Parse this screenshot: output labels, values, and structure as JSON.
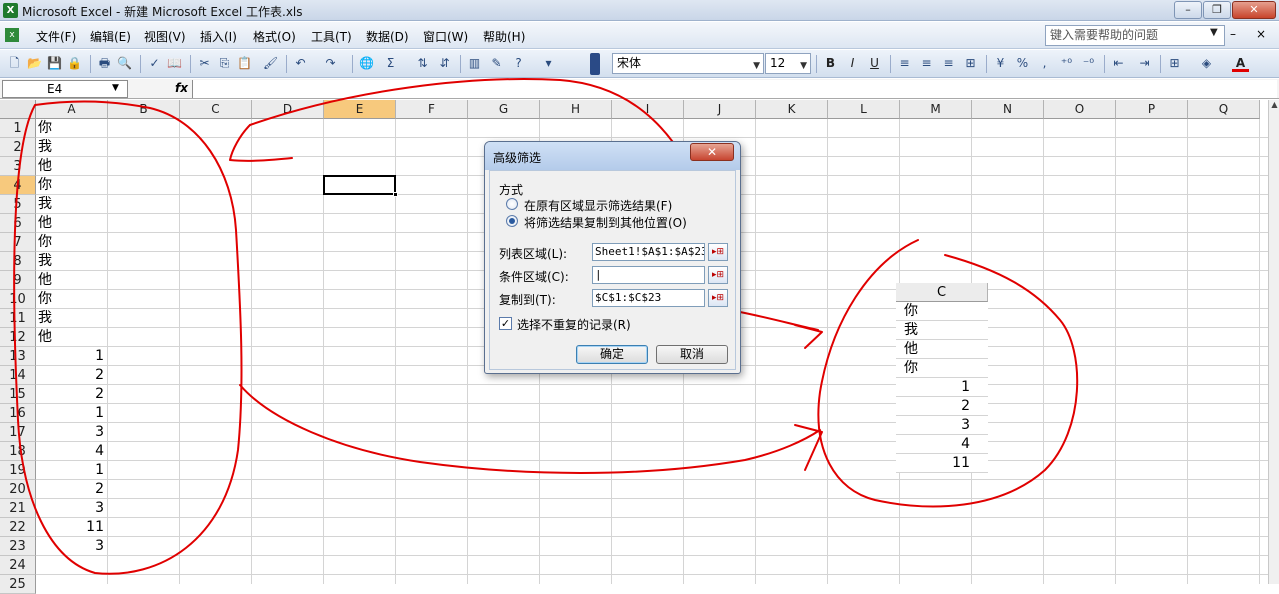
{
  "window": {
    "title": "Microsoft Excel - 新建 Microsoft Excel 工作表.xls",
    "app_icon": "X",
    "min_glyph": "–",
    "max_glyph": "❐",
    "close_glyph": "✕"
  },
  "menu": {
    "doc_icon": "x",
    "items": [
      "文件(F)",
      "编辑(E)",
      "视图(V)",
      "插入(I)",
      "格式(O)",
      "工具(T)",
      "数据(D)",
      "窗口(W)",
      "帮助(H)"
    ],
    "help_placeholder": "键入需要帮助的问题",
    "min_glyph": "–",
    "close_glyph": "×"
  },
  "toolbar": {
    "icons": [
      "new-icon",
      "open-icon",
      "save-icon",
      "permission-icon",
      "print-icon",
      "print-preview-icon",
      "spelling-icon",
      "research-icon",
      "cut-icon",
      "copy-icon",
      "paste-icon",
      "format-painter-icon",
      "undo-icon",
      "redo-icon",
      "hyperlink-icon",
      "autosum-icon",
      "sort-asc-icon",
      "sort-desc-icon",
      "chart-wizard-icon",
      "drawing-icon",
      "help-icon"
    ],
    "font": "宋体",
    "size": "12",
    "format_icons": [
      "bold-icon",
      "italic-icon",
      "underline-icon",
      "align-left-icon",
      "align-center-icon",
      "align-right-icon",
      "merge-center-icon",
      "currency-icon",
      "percent-icon",
      "comma-icon",
      "increase-decimal-icon",
      "decrease-decimal-icon",
      "decrease-indent-icon",
      "increase-indent-icon",
      "borders-icon",
      "fill-color-icon",
      "font-color-icon"
    ],
    "bold": "B",
    "italic": "I",
    "underline": "U",
    "percent": "%",
    "font_color_letter": "A",
    "font_color": "#e00000",
    "fill_color": "#ffff00"
  },
  "formula_bar": {
    "name_box": "E4",
    "fx": "fx",
    "formula": ""
  },
  "sheet": {
    "columns": [
      "A",
      "B",
      "C",
      "D",
      "E",
      "F",
      "G",
      "H",
      "I",
      "J",
      "K",
      "L",
      "M",
      "N",
      "O",
      "P",
      "Q"
    ],
    "active_column": "E",
    "active_row": 4,
    "rows": [
      "1",
      "2",
      "3",
      "4",
      "5",
      "6",
      "7",
      "8",
      "9",
      "10",
      "11",
      "12",
      "13",
      "14",
      "15",
      "16",
      "17",
      "18",
      "19",
      "20",
      "21",
      "22",
      "23",
      "24",
      "25"
    ],
    "column_a": [
      "你",
      "我",
      "他",
      "你",
      "我",
      "他",
      "你",
      "我",
      "他",
      "你",
      "我",
      "他",
      "1",
      "2",
      "2",
      "1",
      "3",
      "4",
      "1",
      "2",
      "3",
      "11",
      "3"
    ]
  },
  "result": {
    "header": "C",
    "values": [
      "你",
      "我",
      "他",
      "你",
      "1",
      "2",
      "3",
      "4",
      "11"
    ]
  },
  "dialog": {
    "title": "高级筛选",
    "close_glyph": "✕",
    "group_label": "方式",
    "option_inplace": "在原有区域显示筛选结果(F)",
    "option_copy": "将筛选结果复制到其他位置(O)",
    "list_range_label": "列表区域(L):",
    "list_range_value": "Sheet1!$A$1:$A$23",
    "criteria_label": "条件区域(C):",
    "criteria_value": "|",
    "copy_to_label": "复制到(T):",
    "copy_to_value": "$C$1:$C$23",
    "unique_label": "选择不重复的记录(R)",
    "unique_checked_glyph": "✓",
    "ok_label": "确定",
    "cancel_label": "取消",
    "ref_glyph": "▸⊞"
  },
  "annotation_color": "#e00000"
}
